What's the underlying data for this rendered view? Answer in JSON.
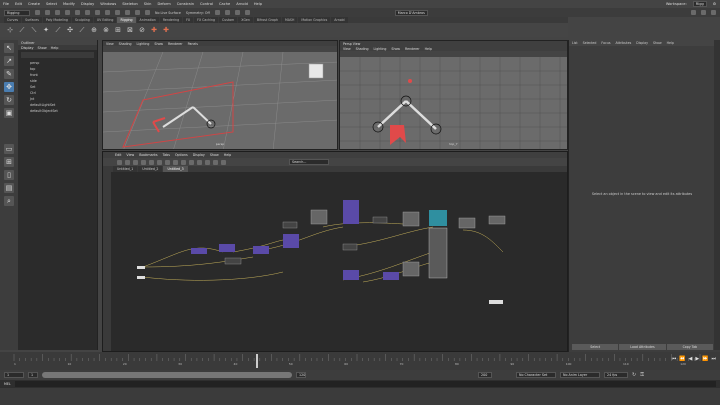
{
  "menubar": {
    "items": [
      "File",
      "Edit",
      "Create",
      "Select",
      "Modify",
      "Display",
      "Windows",
      "Skeleton",
      "Skin",
      "Deform",
      "Constrain",
      "Control",
      "Cache",
      "Arnold",
      "Help"
    ],
    "workspace_label": "Workspace:",
    "workspace_value": "Rigg"
  },
  "statusline": {
    "menuset": "Rigging",
    "symmetry": "No Live Surface",
    "symmetry2": "Symmetry: Off",
    "signin": "Marco D'Ambros"
  },
  "shelf_tabs": {
    "items": [
      "Curves",
      "Surfaces",
      "Poly Modeling",
      "Sculpting",
      "UV Editing",
      "Rigging",
      "Animation",
      "Rendering",
      "FX",
      "FX Caching",
      "Custom",
      "XGen",
      "Bifrost Graph",
      "MASH",
      "Motion Graphics",
      "Arnold"
    ],
    "active_index": 5
  },
  "outliner": {
    "title": "Outliner",
    "menu": [
      "Display",
      "Show",
      "Help"
    ],
    "items": [
      "persp",
      "top",
      "front",
      "side",
      "Set",
      "Ctrl",
      "Jnt",
      "defaultLightSet",
      "defaultObjectSet"
    ]
  },
  "viewport_left": {
    "menu": [
      "View",
      "Shading",
      "Lighting",
      "Show",
      "Renderer",
      "Panels"
    ],
    "camera": "persp"
  },
  "viewport_right": {
    "title": "Persp View",
    "menu": [
      "View",
      "Shading",
      "Lighting",
      "Show",
      "Renderer",
      "Help"
    ],
    "camera": "top_Y"
  },
  "node_editor": {
    "menu": [
      "Edit",
      "View",
      "Bookmarks",
      "Tabs",
      "Options",
      "Display",
      "Show",
      "Help"
    ],
    "tabs": [
      "Untitled_1",
      "Untitled_2",
      "Untitled_3"
    ],
    "active_tab": 2,
    "search_placeholder": "Search..."
  },
  "attribute_editor": {
    "menu": [
      "List",
      "Selected",
      "Focus",
      "Attributes",
      "Display",
      "Show",
      "Help"
    ],
    "message": "Select an object in the scene to view and edit its attributes",
    "buttons": [
      "Select",
      "Load Attributes",
      "Copy Tab"
    ]
  },
  "timeline": {
    "ticks": [
      "1",
      "5",
      "10",
      "15",
      "20",
      "25",
      "30",
      "35",
      "40",
      "45",
      "50",
      "55",
      "60",
      "65",
      "70",
      "75",
      "80",
      "85",
      "90",
      "95",
      "100",
      "105",
      "110",
      "115",
      "120"
    ],
    "current_frame": "1"
  },
  "range": {
    "start": "1",
    "inner_start": "1",
    "inner_end": "120",
    "end": "120",
    "end2": "200",
    "char_set": "No Character Set",
    "anim_layer": "No Anim Layer",
    "fps": "24 fps"
  },
  "cmdline": {
    "lang": "MEL"
  },
  "colors": {
    "accent": "#5b49b0",
    "selection_red": "#e04a4a",
    "bg": "#444444"
  }
}
